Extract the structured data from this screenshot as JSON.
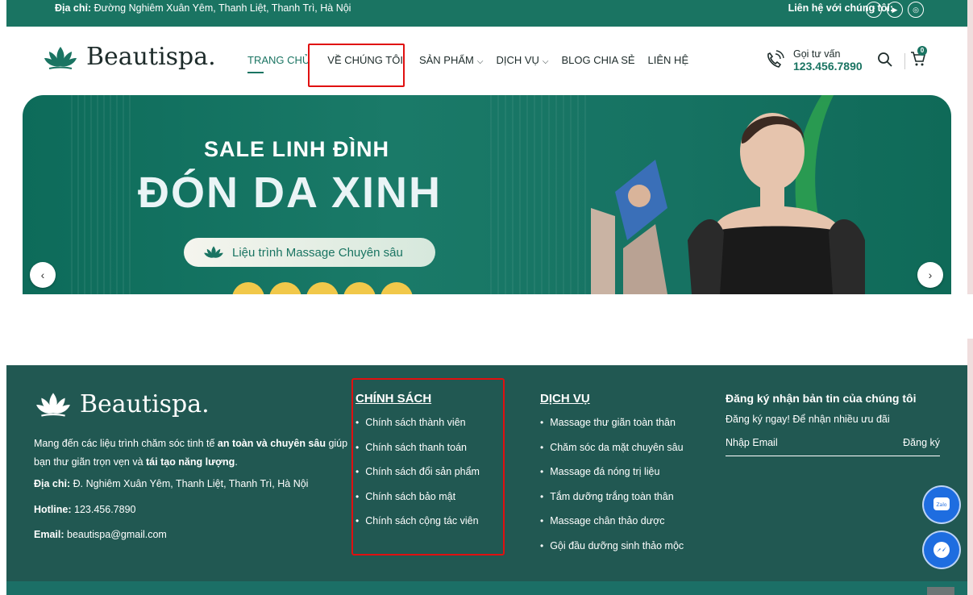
{
  "topbar": {
    "address_label": "Địa chỉ:",
    "address": "Đường Nghiêm Xuân Yêm, Thanh Liệt, Thanh Trì, Hà Nội",
    "contact_label": "Liên hệ với chúng tôi:"
  },
  "header": {
    "brand": "Beautispa.",
    "nav": {
      "home": "TRANG CHỦ",
      "about": "VỀ CHÚNG TÔI",
      "products": "SẢN PHẨM",
      "services": "DỊCH VỤ",
      "blog": "BLOG CHIA SẺ",
      "contact": "LIÊN HỆ"
    },
    "call_label": "Gọi tư vấn",
    "phone": "123.456.7890",
    "cart_count": "0"
  },
  "banner": {
    "line1": "SALE LINH ĐÌNH",
    "line2": "ĐÓN DA XINH",
    "pill": "Liệu trình Massage Chuyên sâu"
  },
  "footer": {
    "brand": "Beautispa.",
    "desc_part1": "Mang đến các liệu trình chăm sóc tinh tế ",
    "desc_bold1": "an toàn và chuyên sâu",
    "desc_part2": " giúp bạn thư giãn trọn vẹn và ",
    "desc_bold2": "tái tạo năng lượng",
    "desc_part3": ".",
    "address_label": "Địa chỉ:",
    "address": " Đ. Nghiêm Xuân Yêm, Thanh Liệt, Thanh Trì, Hà Nội",
    "hotline_label": "Hotline:",
    "hotline": " 123.456.7890",
    "email_label": "Email:",
    "email": " beautispa@gmail.com",
    "policy": {
      "title": "CHÍNH SÁCH",
      "items": [
        "Chính sách thành viên",
        "Chính sách thanh toán",
        "Chính sách đổi sản phẩm",
        "Chính sách bảo mật",
        "Chính sách cộng tác viên"
      ]
    },
    "services": {
      "title": "DỊCH VỤ",
      "items": [
        "Massage thư giãn toàn thân",
        "Chăm sóc da mặt chuyên sâu",
        "Massage đá nóng trị liệu",
        "Tắm dưỡng trắng toàn thân",
        "Massage chân thảo dược",
        "Gội đầu dưỡng sinh thảo mộc"
      ]
    },
    "newsletter": {
      "title": "Đăng ký nhận bản tin của chúng tôi",
      "subtitle": "Đăng ký ngay! Để nhận nhiều ưu đãi",
      "placeholder": "Nhập Email",
      "button": "Đăng ký"
    },
    "zalo_label": "Zalo"
  },
  "colors": {
    "primary": "#1a7462",
    "footer_bg": "#215852",
    "highlight": "#e01010"
  }
}
